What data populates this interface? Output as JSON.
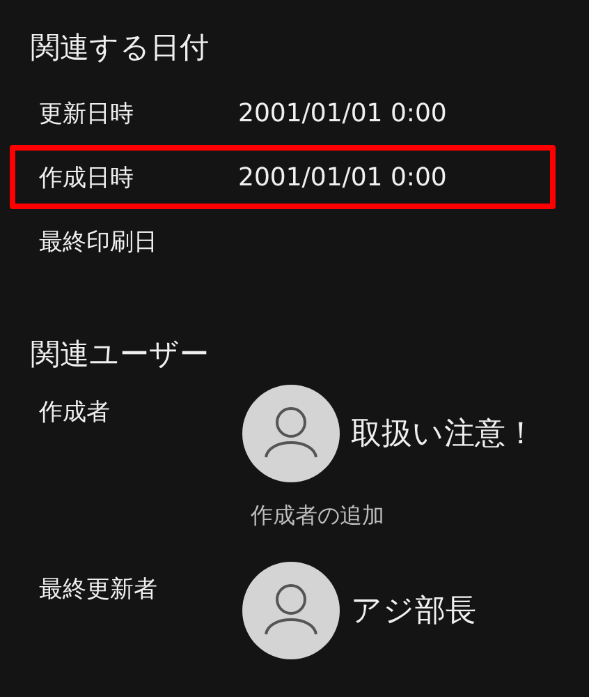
{
  "dates": {
    "title": "関連する日付",
    "rows": [
      {
        "label": "更新日時",
        "value": "2001/01/01 0:00",
        "highlighted": false
      },
      {
        "label": "作成日時",
        "value": "2001/01/01 0:00",
        "highlighted": true
      },
      {
        "label": "最終印刷日",
        "highlighted": false
      }
    ]
  },
  "users": {
    "title": "関連ユーザー",
    "rows": [
      {
        "role": "作成者",
        "name": "取扱い注意！",
        "add_link": "作成者の追加"
      },
      {
        "role": "最終更新者",
        "name": "アジ部長"
      }
    ]
  }
}
